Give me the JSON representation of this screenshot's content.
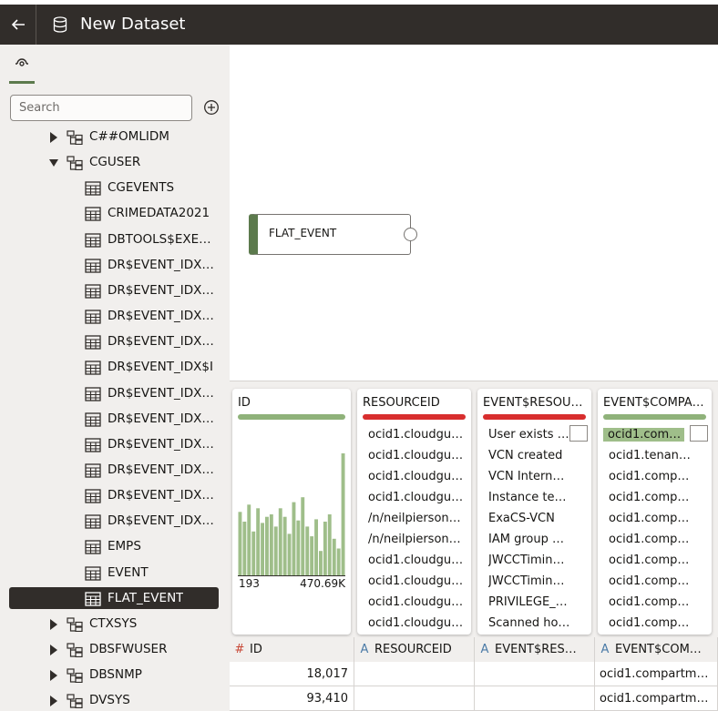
{
  "header": {
    "title": "New Dataset"
  },
  "search": {
    "placeholder": "Search"
  },
  "tree": {
    "schemas_top": [
      {
        "label": "C##OMLIDM"
      },
      {
        "label": "CGUSER"
      }
    ],
    "tables": [
      {
        "label": "CGEVENTS"
      },
      {
        "label": "CRIMEDATA2021"
      },
      {
        "label": "DBTOOLS$EXEC…"
      },
      {
        "label": "DR$EVENT_IDX$…"
      },
      {
        "label": "DR$EVENT_IDX$…"
      },
      {
        "label": "DR$EVENT_IDX$…"
      },
      {
        "label": "DR$EVENT_IDX$…"
      },
      {
        "label": "DR$EVENT_IDX$I"
      },
      {
        "label": "DR$EVENT_IDX$…"
      },
      {
        "label": "DR$EVENT_IDX$…"
      },
      {
        "label": "DR$EVENT_IDX$…"
      },
      {
        "label": "DR$EVENT_IDX$…"
      },
      {
        "label": "DR$EVENT_IDX$…"
      },
      {
        "label": "DR$EVENT_IDX$…"
      },
      {
        "label": "EMPS"
      },
      {
        "label": "EVENT"
      },
      {
        "label": "FLAT_EVENT"
      }
    ],
    "schemas_bottom": [
      {
        "label": "CTXSYS"
      },
      {
        "label": "DBSFWUSER"
      },
      {
        "label": "DBSNMP"
      },
      {
        "label": "DVSYS"
      }
    ]
  },
  "canvas": {
    "node_label": "FLAT_EVENT"
  },
  "cards": [
    {
      "title": "ID",
      "quality_color": "#8fb27a",
      "histogram": [
        52,
        44,
        58,
        36,
        55,
        43,
        48,
        50,
        40,
        55,
        48,
        34,
        60,
        45,
        64,
        40,
        32,
        46,
        20,
        44,
        50,
        30,
        22,
        100
      ],
      "min": "193",
      "max": "470.69K"
    },
    {
      "title": "RESOURCEID",
      "quality_color": "#d82e2e",
      "values": [
        "ocid1.cloudgua…",
        "ocid1.cloudgua…",
        "ocid1.cloudgua…",
        "ocid1.cloudgua…",
        "/n/neilpierson…",
        "/n/neilpierson…",
        "ocid1.cloudgua…",
        "ocid1.cloudgua…",
        "ocid1.cloudgua…",
        "ocid1.cloudgua…"
      ]
    },
    {
      "title": "EVENT$RESOU…",
      "quality_color": "#d82e2e",
      "values": [
        "User exists …",
        "VCN created",
        "VCN Intern…",
        "Instance te…",
        "ExaCS-VCN",
        "IAM group …",
        "JWCCTimin…",
        "JWCCTimin…",
        "PRIVILEGE_…",
        "Scanned ho…"
      ]
    },
    {
      "title": "EVENT$COMPA…",
      "quality_color": "#8fb27a",
      "values": [
        "ocid1.comp…",
        "ocid1.tenan…",
        "ocid1.comp…",
        "ocid1.comp…",
        "ocid1.comp…",
        "ocid1.comp…",
        "ocid1.comp…",
        "ocid1.comp…",
        "ocid1.comp…",
        "ocid1.comp…"
      ]
    }
  ],
  "table": {
    "columns": [
      {
        "type": "#",
        "label": "ID"
      },
      {
        "type": "A",
        "label": "RESOURCEID"
      },
      {
        "type": "A",
        "label": "EVENT$RES…"
      },
      {
        "type": "A",
        "label": "EVENT$COM…"
      }
    ],
    "rows": [
      [
        "18,017",
        "",
        "",
        "ocid1.compartm…"
      ],
      [
        "93,410",
        "",
        "",
        "ocid1.compartm…"
      ]
    ]
  }
}
